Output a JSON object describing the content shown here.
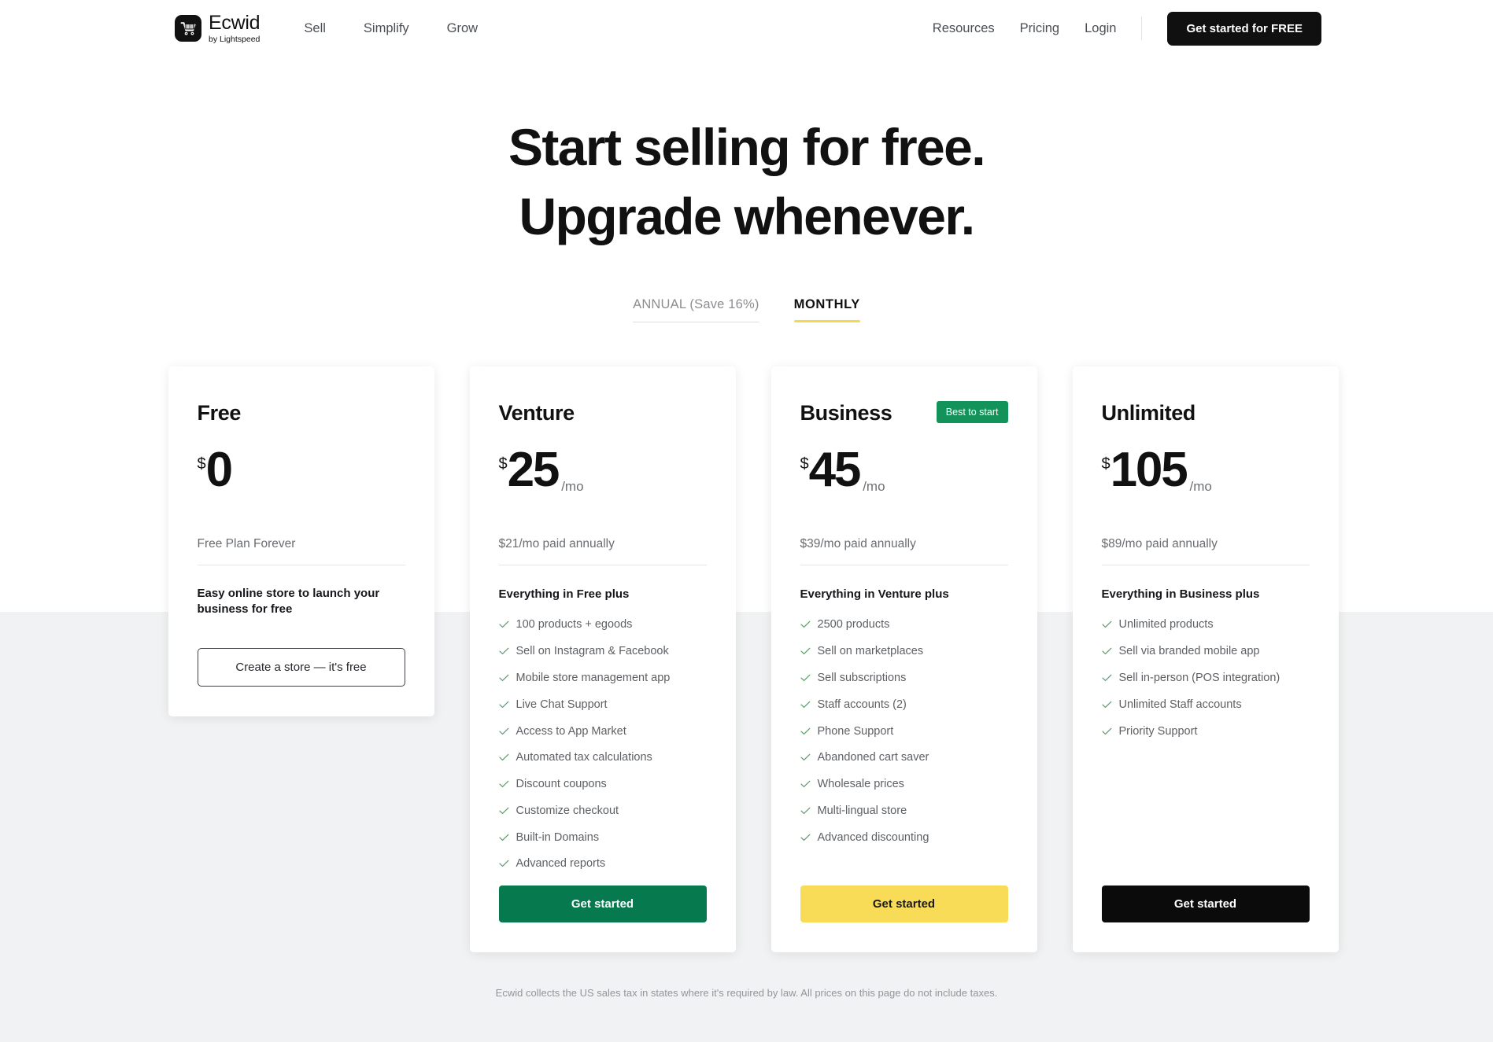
{
  "header": {
    "brand": {
      "name": "Ecwid",
      "sub": "by Lightspeed",
      "icon": "shopping-cart-icon"
    },
    "nav": [
      {
        "label": "Sell"
      },
      {
        "label": "Simplify"
      },
      {
        "label": "Grow"
      }
    ],
    "right_nav": [
      {
        "label": "Resources"
      },
      {
        "label": "Pricing"
      },
      {
        "label": "Login"
      }
    ],
    "cta": "Get started for FREE"
  },
  "hero": {
    "line1": "Start selling for free.",
    "line2": "Upgrade whenever."
  },
  "billing": {
    "annual": "ANNUAL (Save 16%)",
    "monthly": "MONTHLY",
    "selected": "MONTHLY",
    "accent": "#f5d94a"
  },
  "plans": [
    {
      "name": "Free",
      "currency": "$",
      "amount": "0",
      "per": "",
      "sub_price": "Free Plan Forever",
      "blurb": "Easy online store to launch your business for free",
      "badge": "",
      "features_title": "",
      "features": [],
      "button": {
        "label": "Create a store — it's free",
        "style": "outline"
      }
    },
    {
      "name": "Venture",
      "currency": "$",
      "amount": "25",
      "per": "/mo",
      "sub_price": "$21/mo paid annually",
      "blurb": "",
      "badge": "",
      "features_title": "Everything in Free plus",
      "features": [
        "100 products + egoods",
        "Sell on Instagram & Facebook",
        "Mobile store management app",
        "Live Chat Support",
        "Access to App Market",
        "Automated tax calculations",
        "Discount coupons",
        "Customize checkout",
        "Built-in Domains",
        "Advanced reports"
      ],
      "button": {
        "label": "Get started",
        "style": "green"
      }
    },
    {
      "name": "Business",
      "currency": "$",
      "amount": "45",
      "per": "/mo",
      "sub_price": "$39/mo paid annually",
      "blurb": "",
      "badge": "Best to start",
      "features_title": "Everything in Venture plus",
      "features": [
        "2500 products",
        "Sell on marketplaces",
        "Sell subscriptions",
        "Staff accounts (2)",
        "Phone Support",
        "Abandoned cart saver",
        "Wholesale prices",
        "Multi-lingual store",
        "Advanced discounting"
      ],
      "button": {
        "label": "Get started",
        "style": "yellow"
      }
    },
    {
      "name": "Unlimited",
      "currency": "$",
      "amount": "105",
      "per": "/mo",
      "sub_price": "$89/mo paid annually",
      "blurb": "",
      "badge": "",
      "features_title": "Everything in Business plus",
      "features": [
        "Unlimited products",
        "Sell via branded mobile app",
        "Sell in-person (POS integration)",
        "Unlimited Staff accounts",
        "Priority Support"
      ],
      "button": {
        "label": "Get started",
        "style": "black"
      }
    }
  ],
  "footnote": "Ecwid collects the US sales tax in states where it's required by law. All prices on this page do not include taxes."
}
